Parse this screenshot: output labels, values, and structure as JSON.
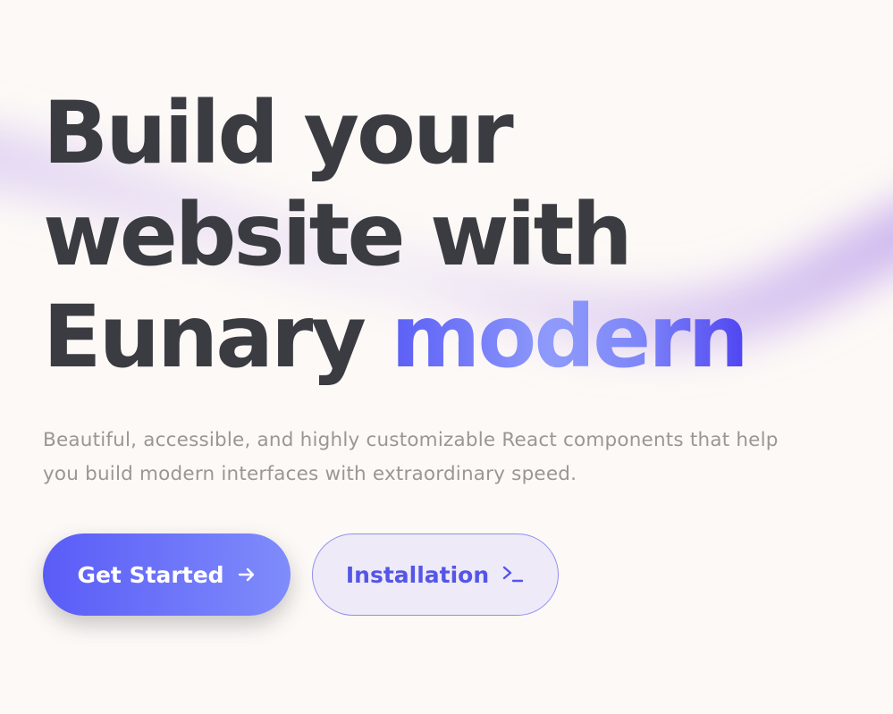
{
  "hero": {
    "headline_line1": "Build your",
    "headline_line2": "website with",
    "headline_line3_prefix": "Eunary",
    "headline_line3_accent": "modern"
  },
  "subtitle_line1": "Beautiful, accessible, and highly customizable React components that help",
  "subtitle_line2": "you build modern interfaces with extraordinary speed.",
  "actions": {
    "primary_label": "Get Started",
    "primary_icon": "arrow-right-icon",
    "secondary_label": "Installation",
    "secondary_icon": "terminal-prompt-icon"
  },
  "colors": {
    "background": "#fdf9f6",
    "headline": "#3b3c41",
    "accent_start": "#5b5ef6",
    "accent_end": "#4f44f1",
    "subtitle": "#9b9693",
    "primary_button": "#5a5cf7",
    "secondary_button_bg": "#efeaf7",
    "secondary_button_text": "#5456e6",
    "wave": "#cdb8f0"
  }
}
